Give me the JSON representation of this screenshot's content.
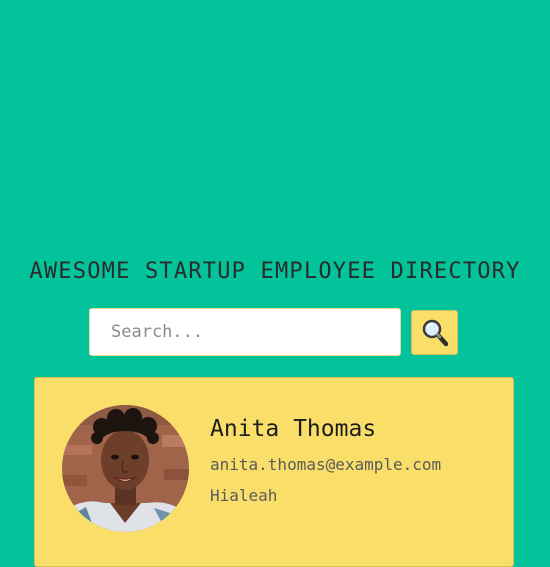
{
  "header": {
    "title": "AWESOME STARTUP EMPLOYEE DIRECTORY"
  },
  "search": {
    "placeholder": "Search...",
    "value": "",
    "button_icon": "magnifying-glass-icon"
  },
  "colors": {
    "background": "#02c39a",
    "card": "#f9df6a",
    "search_button": "#f9df6a"
  },
  "employees": [
    {
      "name": "Anita Thomas",
      "email": "anita.thomas@example.com",
      "city": "Hialeah",
      "avatar_icon": "employee-photo"
    }
  ]
}
